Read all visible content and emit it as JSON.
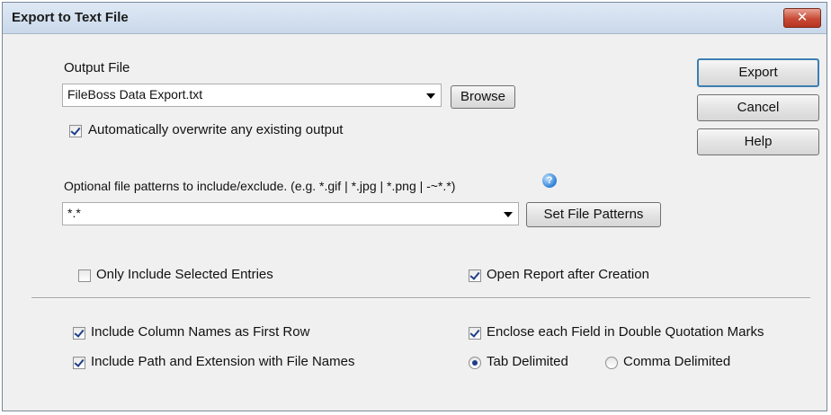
{
  "window": {
    "title": "Export to Text File",
    "close_glyph": "✕"
  },
  "output_file": {
    "label": "Output File",
    "value": "FileBoss Data Export.txt",
    "browse_label": "Browse",
    "overwrite_label": "Automatically overwrite any existing output",
    "overwrite_checked": true
  },
  "patterns": {
    "label": "Optional file patterns to include/exclude. (e.g. *.gif | *.jpg | *.png | -~*.*)",
    "value": "*.*",
    "set_button_label": "Set File Patterns",
    "help_glyph": "?"
  },
  "options": {
    "only_selected_label": "Only Include Selected Entries",
    "only_selected_checked": false,
    "open_report_label": "Open Report after Creation",
    "open_report_checked": true,
    "column_names_label": "Include Column Names as First Row",
    "column_names_checked": true,
    "path_extension_label": "Include Path and Extension with File Names",
    "path_extension_checked": true,
    "enclose_label": "Enclose each Field in Double Quotation Marks",
    "enclose_checked": true,
    "tab_delimited_label": "Tab Delimited",
    "comma_delimited_label": "Comma Delimited",
    "delimiter_selected": "tab"
  },
  "actions": {
    "export_label": "Export",
    "cancel_label": "Cancel",
    "help_label": "Help"
  }
}
